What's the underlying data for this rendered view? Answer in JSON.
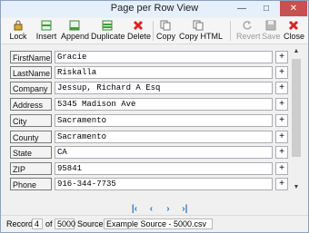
{
  "window": {
    "title": "Page per Row View"
  },
  "toolbar": {
    "lock": "Lock",
    "insert": "Insert",
    "append": "Append",
    "duplicate": "Duplicate",
    "delete": "Delete",
    "copy": "Copy",
    "copy_html": "Copy HTML",
    "revert": "Revert",
    "save": "Save",
    "close": "Close"
  },
  "fields": [
    {
      "label": "FirstName",
      "value": "Gracie"
    },
    {
      "label": "LastName",
      "value": "Riskalla"
    },
    {
      "label": "Company",
      "value": "Jessup, Richard A Esq"
    },
    {
      "label": "Address",
      "value": "5345 Madison Ave"
    },
    {
      "label": "City",
      "value": "Sacramento"
    },
    {
      "label": "County",
      "value": "Sacramento"
    },
    {
      "label": "State",
      "value": "CA"
    },
    {
      "label": "ZIP",
      "value": "95841"
    },
    {
      "label": "Phone",
      "value": "916-344-7735"
    }
  ],
  "plus_label": "+",
  "status": {
    "record_label": "Record",
    "record_value": "4",
    "of_label": "of",
    "total": "5000",
    "source_label": "Source",
    "source_value": "Example Source - 5000.csv"
  },
  "colors": {
    "accent": "#2b78c2",
    "delete_red": "#d22",
    "close_btn": "#c75050"
  }
}
